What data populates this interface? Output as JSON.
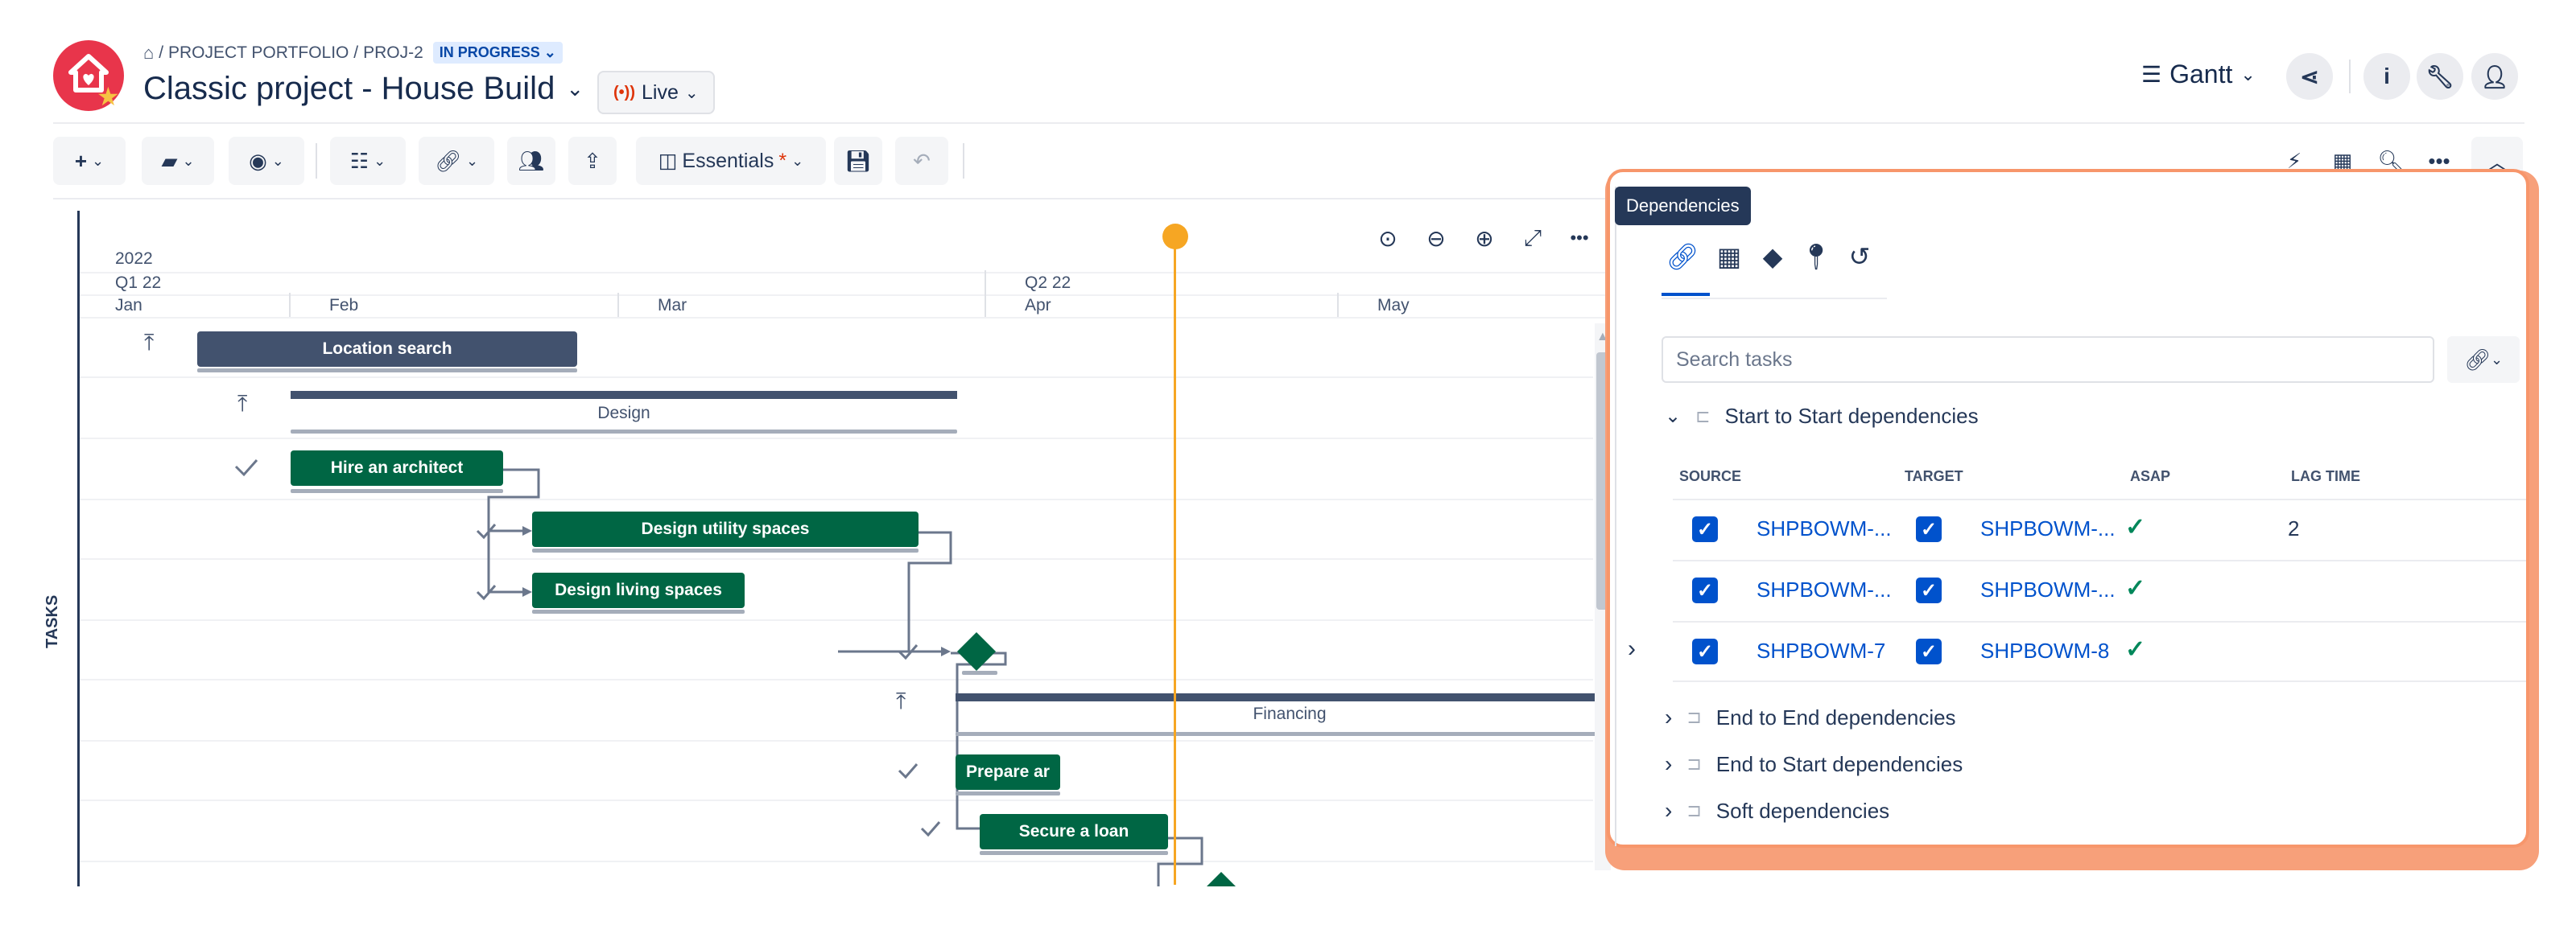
{
  "header": {
    "breadcrumb": {
      "portfolio": "/ PROJECT PORTFOLIO /",
      "project_key": "PROJ-2",
      "status": "IN PROGRESS"
    },
    "title": "Classic project - House Build",
    "live_label": "Live",
    "view_label": "Gantt"
  },
  "toolbar": {
    "essentials_label": "Essentials",
    "essentials_marker": "*"
  },
  "timeline": {
    "year": "2022",
    "quarters": [
      "Q1 22",
      "Q2 22"
    ],
    "months": [
      "Jan",
      "Feb",
      "Mar",
      "Apr",
      "May"
    ]
  },
  "tasks_label": "TASKS",
  "tasks": {
    "location_search": "Location search",
    "design": "Design",
    "hire_architect": "Hire an architect",
    "design_utility": "Design utility spaces",
    "design_living": "Design living spaces",
    "financing": "Financing",
    "prepare": "Prepare ar",
    "secure_loan": "Secure a loan"
  },
  "panel": {
    "tooltip": "Dependencies",
    "tabs": [
      "link-icon",
      "calendar-icon",
      "milestone-icon",
      "marker-icon",
      "history-icon"
    ],
    "search_placeholder": "Search tasks",
    "section_open": "Start to Start dependencies",
    "columns": [
      "SOURCE",
      "TARGET",
      "ASAP",
      "LAG TIME"
    ],
    "rows": [
      {
        "source": "SHPBOWM-...",
        "target": "SHPBOWM-...",
        "lag": "2"
      },
      {
        "source": "SHPBOWM-...",
        "target": "SHPBOWM-...",
        "lag": ""
      },
      {
        "source": "SHPBOWM-7",
        "target": "SHPBOWM-8",
        "lag": ""
      }
    ],
    "sections_closed": [
      "End to End dependencies",
      "End to Start dependencies",
      "Soft dependencies"
    ]
  }
}
